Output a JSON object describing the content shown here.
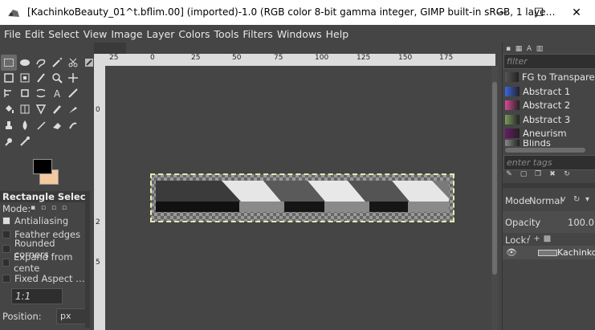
{
  "window": {
    "title": "[KachinkoBeauty_01^t.bflim.00] (imported)-1.0 (RGB color 8-bit gamma integer, GIMP built-in sRGB, 1 laye…",
    "minimize_glyph": "—",
    "maximize_glyph": "☐",
    "close_glyph": "✕"
  },
  "menu": [
    "File",
    "Edit",
    "Select",
    "View",
    "Image",
    "Layer",
    "Colors",
    "Tools",
    "Filters",
    "Windows",
    "Help"
  ],
  "tool_options": {
    "title": "Rectangle Select",
    "mode_label": "Mode:",
    "antialiasing": "Antialiasing",
    "feather_edges": "Feather edges",
    "rounded_corners": "Rounded corners",
    "expand_from_center": "Expand from cente",
    "fixed_aspect": "Fixed Aspect …",
    "ratio": "1:1",
    "position_label": "Position:",
    "position_unit": "px"
  },
  "ruler": {
    "top_ticks": [
      "25",
      "0",
      "25",
      "50",
      "75",
      "100",
      "125",
      "150",
      "175"
    ],
    "left_ticks": [
      "0",
      "2",
      "5"
    ]
  },
  "gradients": {
    "filter_placeholder": "filter",
    "items": [
      {
        "name": "FG to Transparen",
        "swatch": "#555"
      },
      {
        "name": "Abstract 1",
        "swatch": "#3d66e0"
      },
      {
        "name": "Abstract 2",
        "swatch": "#d84a9a"
      },
      {
        "name": "Abstract 3",
        "swatch": "#7a9c5a"
      },
      {
        "name": "Aneurism",
        "swatch": "#6a1a6a"
      },
      {
        "name": "Blinds",
        "swatch": "#888"
      }
    ],
    "tags_placeholder": "enter tags"
  },
  "layers": {
    "mode_label": "Mode",
    "mode_value": "Normal",
    "opacity_label": "Opacity",
    "opacity_value": "100.0",
    "lock_label": "Lock:",
    "layer_name": "KachinkoB"
  },
  "colors": {
    "fg": "#000000",
    "bg": "#f4c9a0"
  }
}
